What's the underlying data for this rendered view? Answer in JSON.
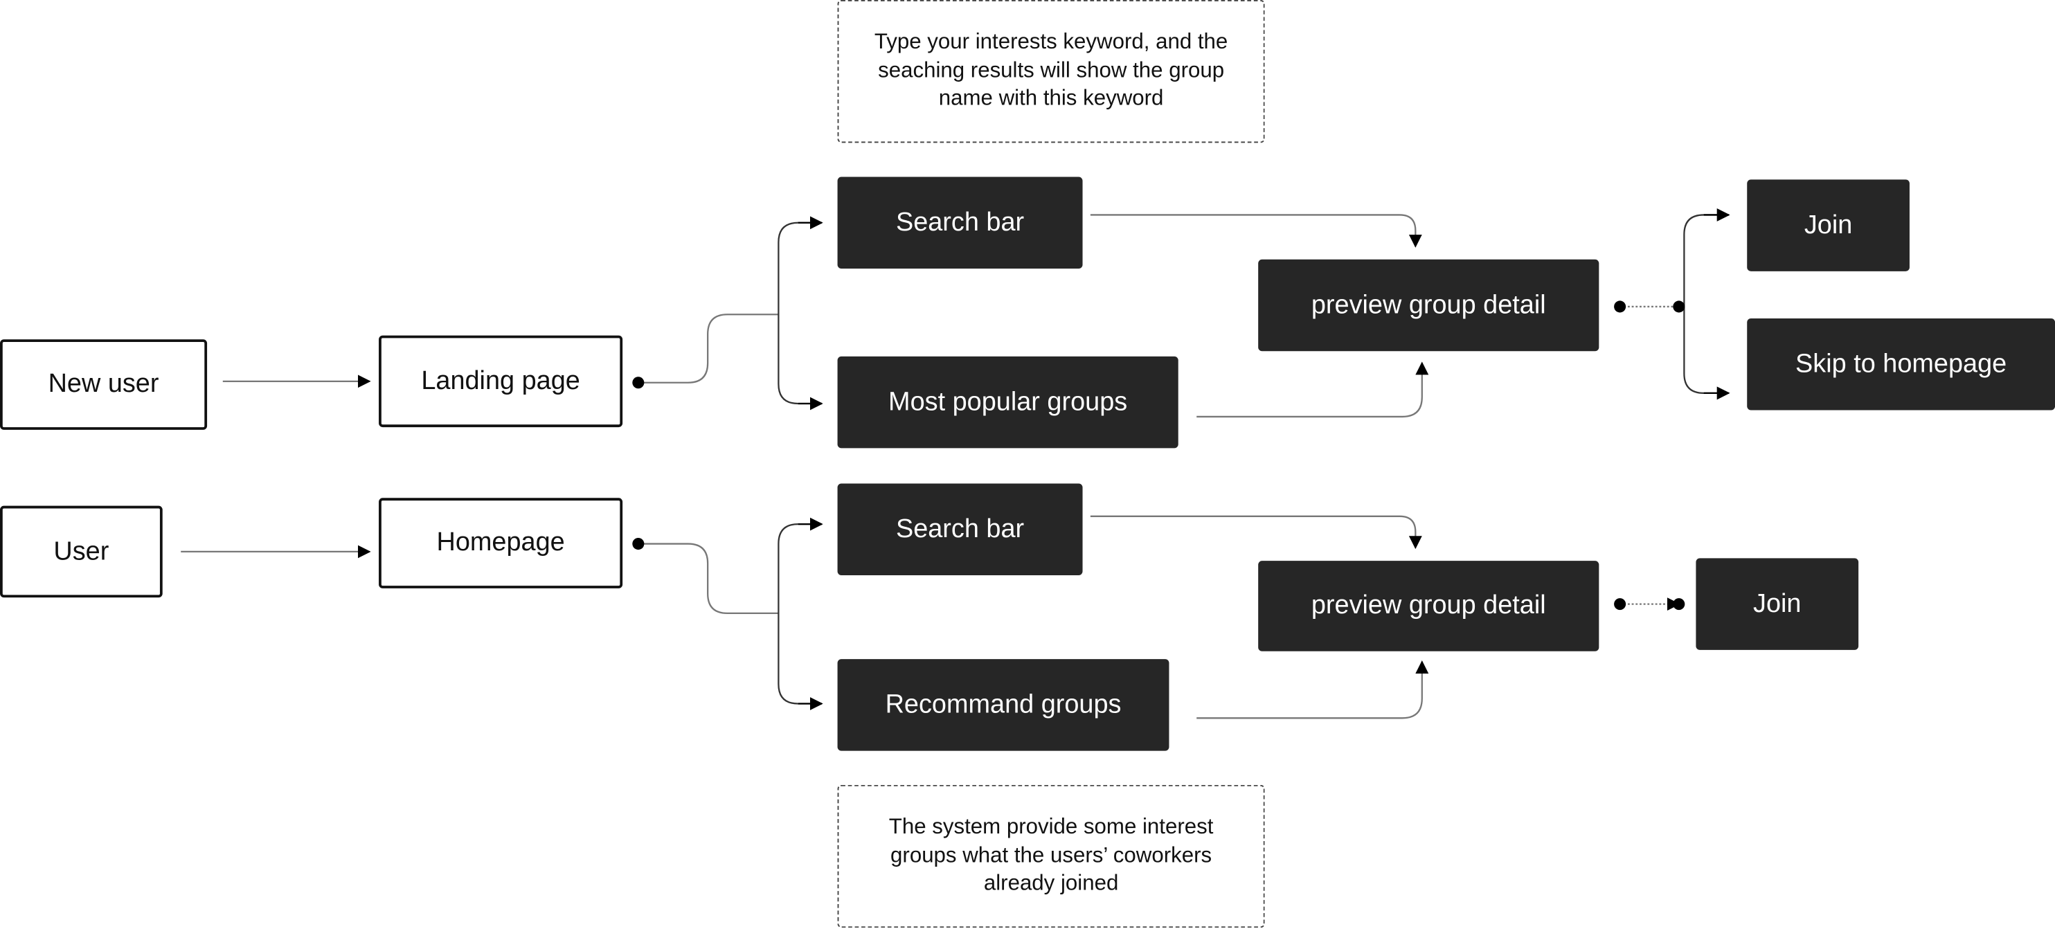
{
  "nodes": {
    "new_user": "New user",
    "landing_page": "Landing page",
    "user": "User",
    "homepage": "Homepage",
    "search_bar_top": "Search bar",
    "most_popular_groups": "Most popular groups",
    "preview_top": "preview group detail",
    "join_top": "Join",
    "skip_to_homepage": "Skip to homepage",
    "search_bar_bottom": "Search bar",
    "recommand_groups": "Recommand groups",
    "preview_bottom": "preview group detail",
    "join_bottom": "Join"
  },
  "notes": {
    "search_note": "Type your interests keyword, and the seaching results will show the group name with this keyword",
    "recommend_note": "The system provide some interest groups what the users’ coworkers already joined"
  },
  "colors": {
    "dark_node": "#262626",
    "light_node_border": "#111111",
    "connector": "#777777"
  }
}
